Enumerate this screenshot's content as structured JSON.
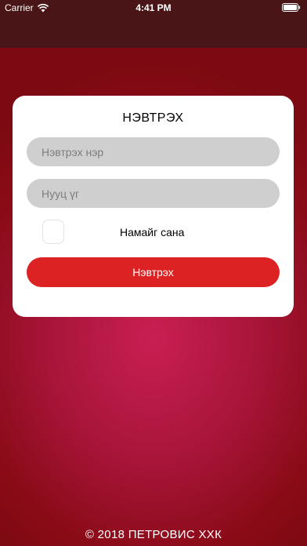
{
  "status_bar": {
    "carrier": "Carrier",
    "time": "4:41 PM",
    "wifi_icon": "wifi-icon",
    "battery_icon": "battery-icon"
  },
  "colors": {
    "header": "#4a1516",
    "background_center": "#c91f52",
    "background_edge": "#7d0a12",
    "accent": "#dc2223",
    "field_background": "#cfcfcf"
  },
  "login_card": {
    "title": "НЭВТРЭХ",
    "username": {
      "value": "",
      "placeholder": "Нэвтрэх нэр"
    },
    "password": {
      "value": "",
      "placeholder": "Нууц үг"
    },
    "remember_me": {
      "label": "Намайг сана",
      "checked": false
    },
    "submit_label": "Нэвтрэх"
  },
  "footer": {
    "copyright": "© 2018 ПЕТРОВИС ХХК"
  }
}
